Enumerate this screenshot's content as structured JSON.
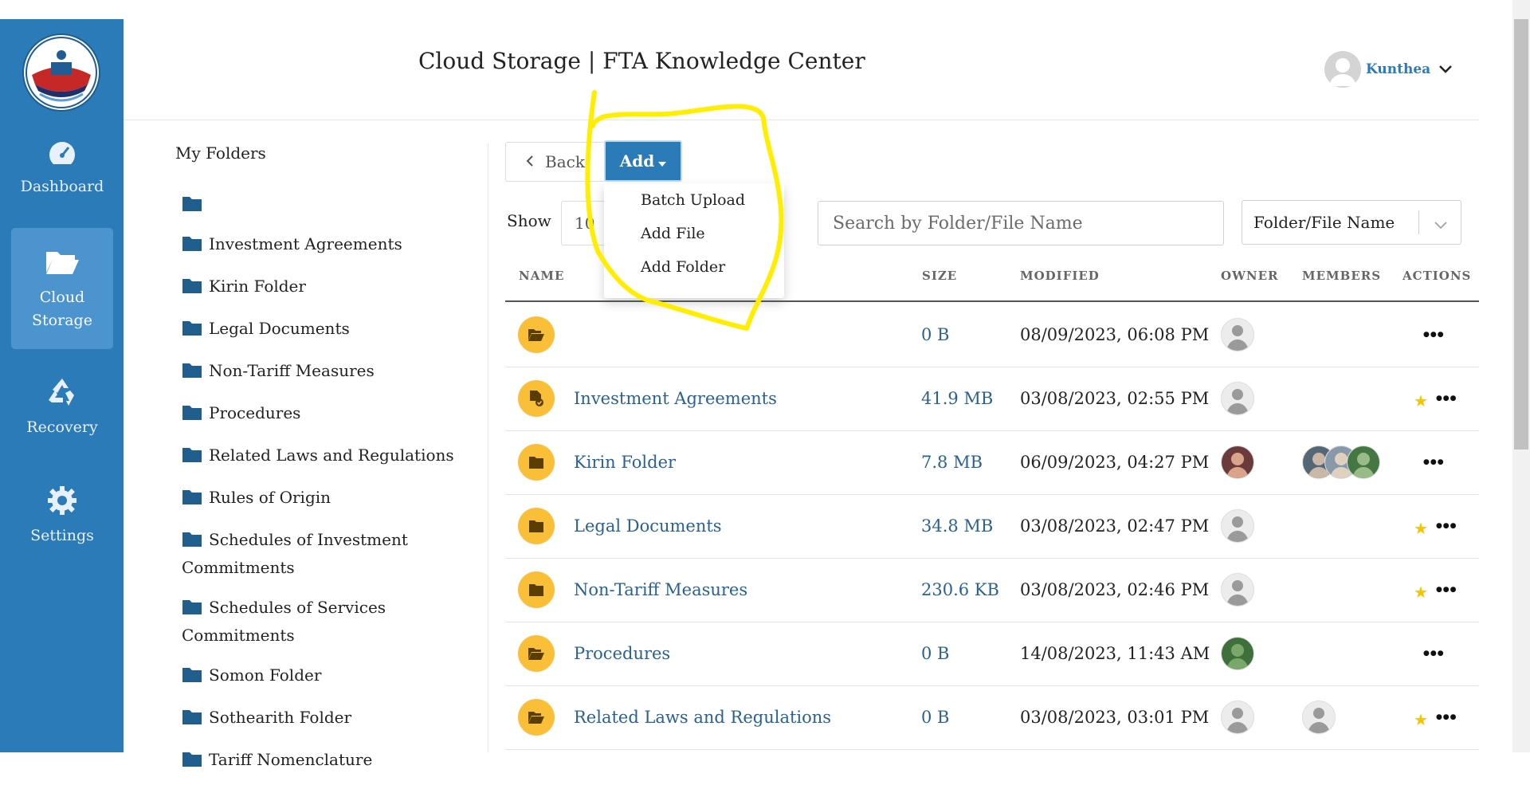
{
  "app": {
    "title": "Cloud Storage | FTA Knowledge Center"
  },
  "user": {
    "name": "Kunthea"
  },
  "sidebar": {
    "items": [
      {
        "label": "Dashboard",
        "icon": "dashboard-icon"
      },
      {
        "label": "Cloud Storage",
        "icon": "folder-open-icon",
        "active": true
      },
      {
        "label": "Recovery",
        "icon": "recycle-icon"
      },
      {
        "label": "Settings",
        "icon": "gear-icon"
      }
    ]
  },
  "tree": {
    "title": "My Folders",
    "items": [
      "",
      "Investment Agreements",
      "Kirin Folder",
      "Legal Documents",
      "Non-Tariff Measures",
      "Procedures",
      "Related Laws and Regulations",
      "Rules of Origin",
      "Schedules of Investment Commitments",
      "Schedules of Services Commitments",
      "Somon Folder",
      "Sothearith Folder",
      "Tariff Nomenclature"
    ]
  },
  "toolbar": {
    "back_label": "Back",
    "add_label": "Add",
    "add_menu": [
      "Batch Upload",
      "Add File",
      "Add Folder"
    ],
    "show_label": "Show",
    "show_value": "10",
    "search_placeholder": "Search by Folder/File Name",
    "filter_value": "Folder/File Name"
  },
  "table": {
    "headers": {
      "name": "NAME",
      "size": "SIZE",
      "modified": "MODIFIED",
      "owner": "OWNER",
      "members": "MEMBERS",
      "actions": "ACTIONS"
    },
    "rows": [
      {
        "name": "",
        "size": "0 B",
        "modified": "08/09/2023, 06:08 PM",
        "icon": "folder-open-icon",
        "owner": "default",
        "members": [],
        "starred": false
      },
      {
        "name": "Investment Agreements",
        "size": "41.9 MB",
        "modified": "03/08/2023, 02:55 PM",
        "icon": "file-check-icon",
        "owner": "default",
        "members": [],
        "starred": true
      },
      {
        "name": "Kirin Folder",
        "size": "7.8 MB",
        "modified": "06/09/2023, 04:27 PM",
        "icon": "folder-icon",
        "owner": "photo",
        "members": [
          "photo",
          "photo",
          "photo"
        ],
        "starred": false
      },
      {
        "name": "Legal Documents",
        "size": "34.8 MB",
        "modified": "03/08/2023, 02:47 PM",
        "icon": "folder-icon",
        "owner": "default",
        "members": [],
        "starred": true
      },
      {
        "name": "Non-Tariff Measures",
        "size": "230.6 KB",
        "modified": "03/08/2023, 02:46 PM",
        "icon": "folder-icon",
        "owner": "default",
        "members": [],
        "starred": true
      },
      {
        "name": "Procedures",
        "size": "0 B",
        "modified": "14/08/2023, 11:43 AM",
        "icon": "folder-open-icon",
        "owner": "photo",
        "members": [],
        "starred": false
      },
      {
        "name": "Related Laws and Regulations",
        "size": "0 B",
        "modified": "03/08/2023, 03:01 PM",
        "icon": "folder-open-icon",
        "owner": "default",
        "members": [
          "default"
        ],
        "starred": true
      }
    ]
  },
  "colors": {
    "sidebar": "#2b7bb9",
    "accent": "#2b7bb9",
    "folder_badge": "#f9bf38",
    "star": "#f5c400",
    "annotation": "#ffee00"
  }
}
